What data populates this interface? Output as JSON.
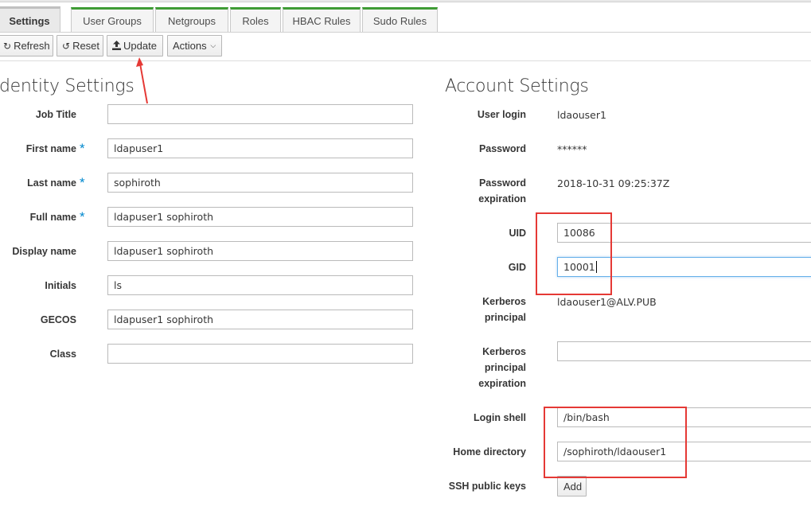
{
  "tabs": [
    {
      "label": "Settings",
      "active": true
    },
    {
      "label": "User Groups",
      "active": false
    },
    {
      "label": "Netgroups",
      "active": false
    },
    {
      "label": "Roles",
      "active": false
    },
    {
      "label": "HBAC Rules",
      "active": false
    },
    {
      "label": "Sudo Rules",
      "active": false
    }
  ],
  "toolbar": {
    "refresh_label": "Refresh",
    "reset_label": "Reset",
    "update_label": "Update",
    "actions_label": "Actions"
  },
  "identity": {
    "title": "dentity Settings",
    "job_title": {
      "label": "Job Title",
      "value": ""
    },
    "first_name": {
      "label": "First name",
      "value": "ldapuser1",
      "required": true
    },
    "last_name": {
      "label": "Last name",
      "value": "sophiroth",
      "required": true
    },
    "full_name": {
      "label": "Full name",
      "value": "ldapuser1 sophiroth",
      "required": true
    },
    "display_name": {
      "label": "Display name",
      "value": "ldapuser1 sophiroth"
    },
    "initials": {
      "label": "Initials",
      "value": "ls"
    },
    "gecos": {
      "label": "GECOS",
      "value": "ldapuser1 sophiroth"
    },
    "class": {
      "label": "Class",
      "value": ""
    }
  },
  "account": {
    "title": "Account Settings",
    "user_login": {
      "label": "User login",
      "value": "ldaouser1"
    },
    "password": {
      "label": "Password",
      "value": "******"
    },
    "password_expiration": {
      "label_line1": "Password",
      "label_line2": "expiration",
      "value": "2018-10-31 09:25:37Z"
    },
    "uid": {
      "label": "UID",
      "value": "10086"
    },
    "gid": {
      "label": "GID",
      "value": "10001"
    },
    "krb_principal": {
      "label_line1": "Kerberos",
      "label_line2": "principal",
      "value": "ldaouser1@ALV.PUB"
    },
    "krb_expiration": {
      "label_line1": "Kerberos",
      "label_line2": "principal",
      "label_line3": "expiration",
      "value": ""
    },
    "login_shell": {
      "label": "Login shell",
      "value": "/bin/bash"
    },
    "home_directory": {
      "label": "Home directory",
      "value": "/sophiroth/ldaouser1"
    },
    "ssh_keys": {
      "label": "SSH public keys",
      "add_label": "Add"
    }
  },
  "colors": {
    "required_star": "#0088ce",
    "annotation_red": "#e53935",
    "tab_accent": "#3f9c35"
  },
  "icons": {
    "refresh": "refresh-icon",
    "reset": "undo-icon",
    "update": "upload-icon",
    "actions": "chevron-down-icon"
  }
}
